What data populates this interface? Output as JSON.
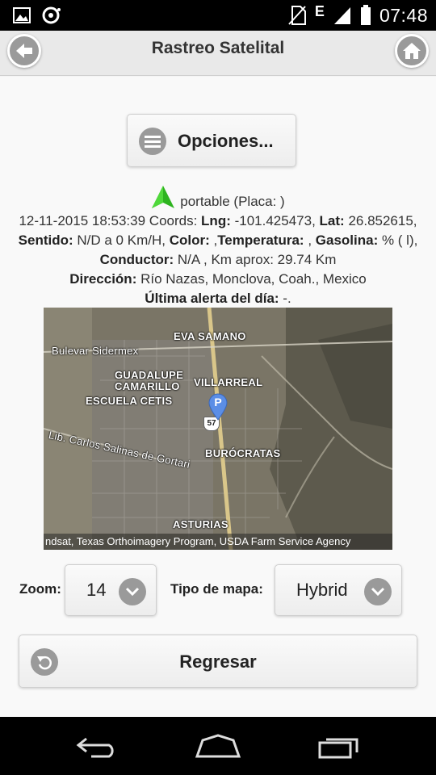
{
  "status_bar": {
    "time": "07:48",
    "network": "E",
    "icons": [
      "image-icon",
      "sync-icon",
      "no-sim-icon",
      "signal-icon",
      "battery-icon"
    ]
  },
  "header": {
    "title": "Rastreo Satelital",
    "left_icon": "back-icon",
    "right_icon": "home-icon"
  },
  "opciones_button": {
    "label": "Opciones...",
    "icon": "menu-icon"
  },
  "vehicle": {
    "icon_color": "#2db31f",
    "line1": "portable (Placa: )",
    "datetime": "12-11-2015 18:53:39",
    "coords_text": " Coords: ",
    "lng_label": "Lng:",
    "lng_value": " -101.425473, ",
    "lat_label": "Lat:",
    "lat_value": "26.852615, ",
    "sentido_label": "Sentido:",
    "sentido_value": " N/D a 0 Km/H, ",
    "color_label": "Color:",
    "color_value": " ,",
    "temperatura_label": "Temperatura:",
    "temperatura_value": " , ",
    "gasolina_label": "Gasolina:",
    "gasolina_value": " % ( l), ",
    "conductor_label": "Conductor:",
    "conductor_value": " N/A , Km aprox: 29.74 Km",
    "direccion_label": "Dirección:",
    "direccion_value": " Río Nazas, Monclova, Coah., Mexico",
    "alerta_label": "Última alerta del día:",
    "alerta_value": " -."
  },
  "map": {
    "labels": {
      "eva_samano": "EVA SAMANO",
      "bulevar": "Bulevar Sidermex",
      "guadalupe": "GUADALUPE",
      "camarillo": "CAMARILLO",
      "villarreal": "VILLARREAL",
      "escuela": "ESCUELA CETIS",
      "carlos": "Lib. Carlos Salinas de Gortari",
      "burocratas": "BURÓCRATAS",
      "asturias": "ASTURIAS",
      "route": "57",
      "pin": "P"
    },
    "attribution": "ndsat, Texas Orthoimagery Program, USDA Farm Service Agency"
  },
  "zoom": {
    "label": "Zoom:",
    "value": "14"
  },
  "map_type": {
    "label": "Tipo de mapa:",
    "value": "Hybrid"
  },
  "regresar_button": {
    "label": "Regresar",
    "icon": "undo-icon"
  },
  "nav_bar": {
    "icons": [
      "nav-back-icon",
      "nav-home-icon",
      "nav-recents-icon"
    ]
  }
}
